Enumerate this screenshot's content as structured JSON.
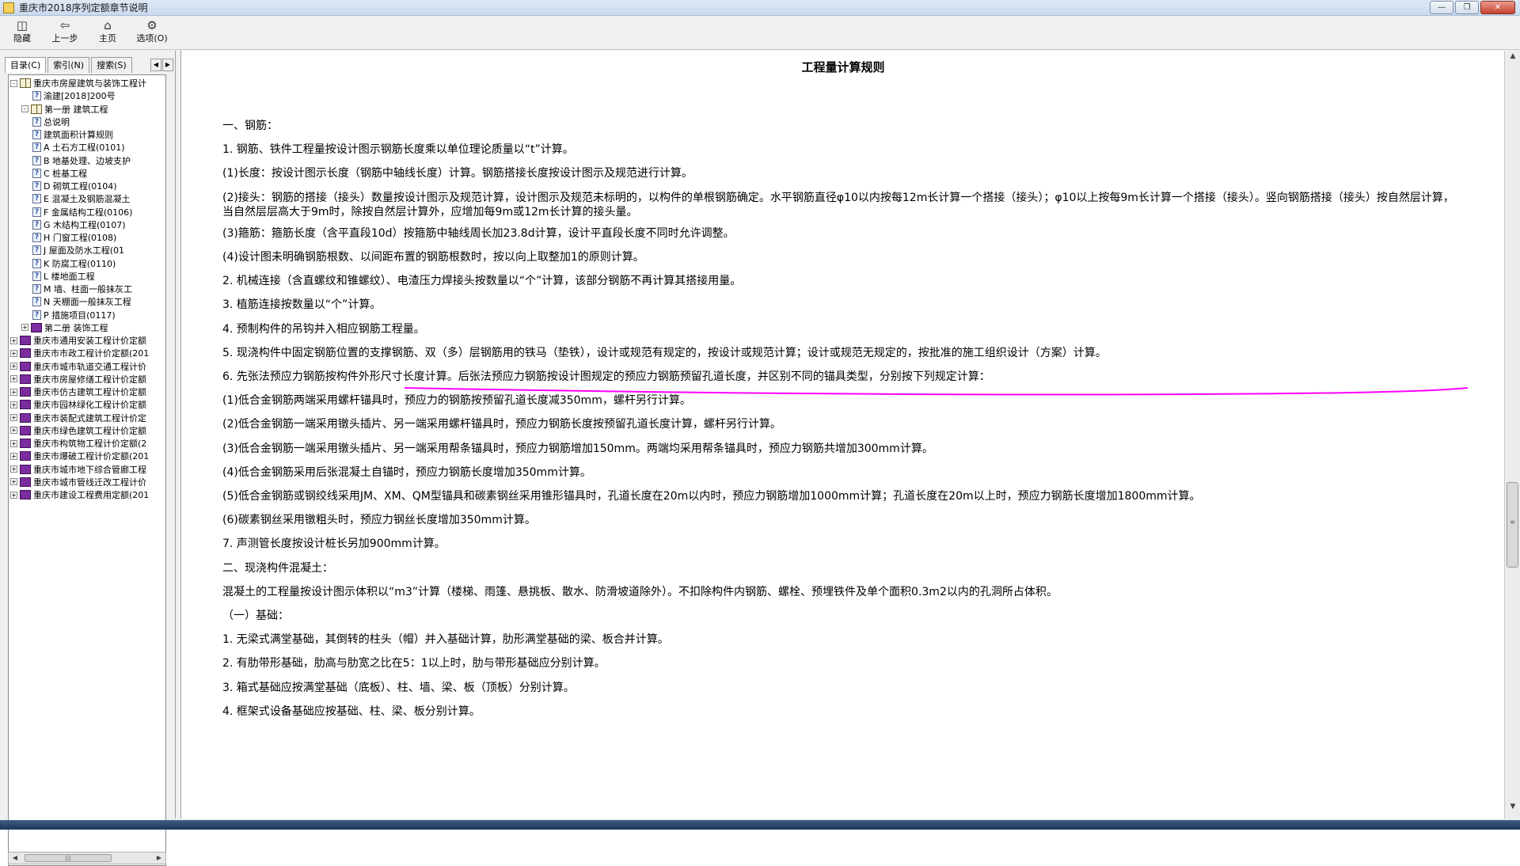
{
  "window": {
    "title": "重庆市2018序列定额章节说明",
    "buttons": [
      "minimize",
      "maximize",
      "close"
    ]
  },
  "toolbar": {
    "hide_label": "隐藏",
    "back_label": "上一步",
    "home_label": "主页",
    "options_label": "选项(O)"
  },
  "sidebar": {
    "tabs": [
      {
        "label": "目录(C)"
      },
      {
        "label": "索引(N)"
      },
      {
        "label": "搜索(S)"
      }
    ],
    "tree": [
      {
        "label": "重庆市房屋建筑与装饰工程计",
        "icon": "open-book-icon",
        "expander": "-"
      },
      {
        "label": "渝建[2018]200号",
        "icon": "help-page-icon",
        "expander": ""
      },
      {
        "label": "第一册 建筑工程",
        "icon": "open-book-icon",
        "expander": "-"
      },
      {
        "label": "总说明",
        "icon": "help-page-icon",
        "expander": ""
      },
      {
        "label": "建筑面积计算规则",
        "icon": "help-page-icon",
        "expander": ""
      },
      {
        "label": "A 土石方工程(0101)",
        "icon": "help-page-icon",
        "expander": ""
      },
      {
        "label": "B 地基处理、边坡支护",
        "icon": "help-page-icon",
        "expander": ""
      },
      {
        "label": "C 桩基工程",
        "icon": "help-page-icon",
        "expander": ""
      },
      {
        "label": "D 砌筑工程(0104)",
        "icon": "help-page-icon",
        "expander": ""
      },
      {
        "label": "E 混凝土及钢筋混凝土",
        "icon": "help-page-icon",
        "expander": ""
      },
      {
        "label": "F 金属结构工程(0106)",
        "icon": "help-page-icon",
        "expander": ""
      },
      {
        "label": "G 木结构工程(0107)",
        "icon": "help-page-icon",
        "expander": ""
      },
      {
        "label": "H 门窗工程(0108)",
        "icon": "help-page-icon",
        "expander": ""
      },
      {
        "label": "J 屋面及防水工程(01",
        "icon": "help-page-icon",
        "expander": ""
      },
      {
        "label": "K 防腐工程(0110)",
        "icon": "help-page-icon",
        "expander": ""
      },
      {
        "label": "L 楼地面工程",
        "icon": "help-page-icon",
        "expander": ""
      },
      {
        "label": "M 墙、柱面一般抹灰工",
        "icon": "help-page-icon",
        "expander": ""
      },
      {
        "label": "N 天棚面一般抹灰工程",
        "icon": "help-page-icon",
        "expander": ""
      },
      {
        "label": "P 措施项目(0117)",
        "icon": "help-page-icon",
        "expander": ""
      },
      {
        "label": "第二册 装饰工程",
        "icon": "closed-book-icon",
        "expander": "+"
      },
      {
        "label": "重庆市通用安装工程计价定额",
        "icon": "closed-book-icon",
        "expander": "+"
      },
      {
        "label": "重庆市市政工程计价定额(201",
        "icon": "closed-book-icon",
        "expander": "+"
      },
      {
        "label": "重庆市城市轨道交通工程计价",
        "icon": "closed-book-icon",
        "expander": "+"
      },
      {
        "label": "重庆市房屋修缮工程计价定额",
        "icon": "closed-book-icon",
        "expander": "+"
      },
      {
        "label": "重庆市仿古建筑工程计价定额",
        "icon": "closed-book-icon",
        "expander": "+"
      },
      {
        "label": "重庆市园林绿化工程计价定额",
        "icon": "closed-book-icon",
        "expander": "+"
      },
      {
        "label": "重庆市装配式建筑工程计价定",
        "icon": "closed-book-icon",
        "expander": "+"
      },
      {
        "label": "重庆市绿色建筑工程计价定额",
        "icon": "closed-book-icon",
        "expander": "+"
      },
      {
        "label": "重庆市构筑物工程计价定额(2",
        "icon": "closed-book-icon",
        "expander": "+"
      },
      {
        "label": "重庆市爆破工程计价定额(201",
        "icon": "closed-book-icon",
        "expander": "+"
      },
      {
        "label": "重庆市城市地下综合管廊工程",
        "icon": "closed-book-icon",
        "expander": "+"
      },
      {
        "label": "重庆市城市管线迁改工程计价",
        "icon": "closed-book-icon",
        "expander": "+"
      },
      {
        "label": "重庆市建设工程费用定额(201",
        "icon": "closed-book-icon",
        "expander": "+"
      }
    ]
  },
  "document": {
    "title": "工程量计算规则",
    "paragraphs": [
      "一、钢筋：",
      "1. 钢筋、铁件工程量按设计图示钢筋长度乘以单位理论质量以“t”计算。",
      "(1)长度：按设计图示长度（钢筋中轴线长度）计算。钢筋搭接长度按设计图示及规范进行计算。",
      "(2)接头：钢筋的搭接（接头）数量按设计图示及规范计算，设计图示及规范未标明的，以构件的单根钢筋确定。水平钢筋直径φ10以内按每12m长计算一个搭接（接头）；φ10以上按每9m长计算一个搭接（接头）。竖向钢筋搭接（接头）按自然层计算，当自然层层高大于9m时，除按自然层计算外，应增加每9m或12m长计算的接头量。",
      "(3)箍筋：箍筋长度（含平直段10d）按箍筋中轴线周长加23.8d计算，设计平直段长度不同时允许调整。",
      "(4)设计图未明确钢筋根数、以间距布置的钢筋根数时，按以向上取整加1的原则计算。",
      "2. 机械连接（含直螺纹和锥螺纹）、电渣压力焊接头按数量以“个”计算，该部分钢筋不再计算其搭接用量。",
      "3. 植筋连接按数量以“个”计算。",
      "4. 预制构件的吊钩并入相应钢筋工程量。",
      "5. 现浇构件中固定钢筋位置的支撑钢筋、双（多）层钢筋用的铁马（垫铁），设计或规范有规定的，按设计或规范计算；设计或规范无规定的，按批准的施工组织设计（方案）计算。",
      "6. 先张法预应力钢筋按构件外形尺寸长度计算。后张法预应力钢筋按设计图规定的预应力钢筋预留孔道长度，并区别不同的锚具类型，分别按下列规定计算：",
      "(1)低合金钢筋两端采用螺杆锚具时，预应力的钢筋按预留孔道长度减350mm，螺杆另行计算。",
      "(2)低合金钢筋一端采用镦头插片、另一端采用螺杆锚具时，预应力钢筋长度按预留孔道长度计算，螺杆另行计算。",
      "(3)低合金钢筋一端采用镦头插片、另一端采用帮条锚具时，预应力钢筋增加150mm。两端均采用帮条锚具时，预应力钢筋共增加300mm计算。",
      "(4)低合金钢筋采用后张混凝土自锚时，预应力钢筋长度增加350mm计算。",
      "(5)低合金钢筋或钢绞线采用JM、XM、QM型锚具和碳素钢丝采用锥形锚具时，孔道长度在20m以内时，预应力钢筋增加1000mm计算；孔道长度在20m以上时，预应力钢筋长度增加1800mm计算。",
      "(6)碳素钢丝采用镦粗头时，预应力钢丝长度增加350mm计算。",
      "7. 声测管长度按设计桩长另加900mm计算。",
      "二、现浇构件混凝土：",
      "混凝土的工程量按设计图示体积以“m3”计算（楼梯、雨篷、悬挑板、散水、防滑坡道除外）。不扣除构件内钢筋、螺栓、预埋铁件及单个面积0.3m2以内的孔洞所占体积。",
      "（一）基础：",
      "1. 无梁式满堂基础，其倒转的柱头（帽）并入基础计算，肋形满堂基础的梁、板合并计算。",
      "2. 有肋带形基础，肋高与肋宽之比在5：1以上时，肋与带形基础应分别计算。",
      "3. 箱式基础应按满堂基础（底板）、柱、墙、梁、板（顶板）分别计算。",
      "4. 框架式设备基础应按基础、柱、梁、板分别计算。"
    ]
  },
  "colors": {
    "annotation_underline": "#ff00ff",
    "closed_book": "#7b2c9e",
    "help_icon": "#2d55a8"
  }
}
